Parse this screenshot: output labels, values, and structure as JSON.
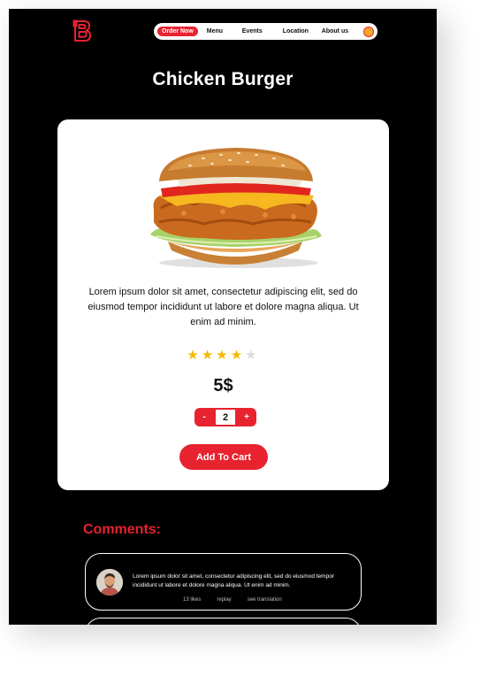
{
  "header": {
    "logo_letter": "B",
    "nav": {
      "order_now": "Order Now",
      "menu": "Menu",
      "events": "Events",
      "location": "Location",
      "about_us": "About us"
    }
  },
  "product": {
    "title": "Chicken Burger",
    "description": "Lorem ipsum dolor sit amet, consectetur adipiscing elit, sed do eiusmod tempor incididunt ut labore et dolore magna aliqua. Ut enim ad minim.",
    "rating": 4,
    "rating_max": 5,
    "price": "5$",
    "quantity": "2",
    "minus_label": "-",
    "plus_label": "+",
    "add_to_cart": "Add To Cart"
  },
  "comments": {
    "heading": "Comments:",
    "items": [
      {
        "text": "Lorem ipsum dolor sit amet, consectetur adipiscing elit, sed do eiusmod tempor incididunt ut labore et dolore magna aliqua. Ut enim ad minim.",
        "likes": "13 likes",
        "reply": "replay",
        "translate": "see translation"
      }
    ]
  },
  "colors": {
    "accent": "#e8222f",
    "background": "#000000",
    "card": "#ffffff",
    "star": "#f5b800"
  }
}
